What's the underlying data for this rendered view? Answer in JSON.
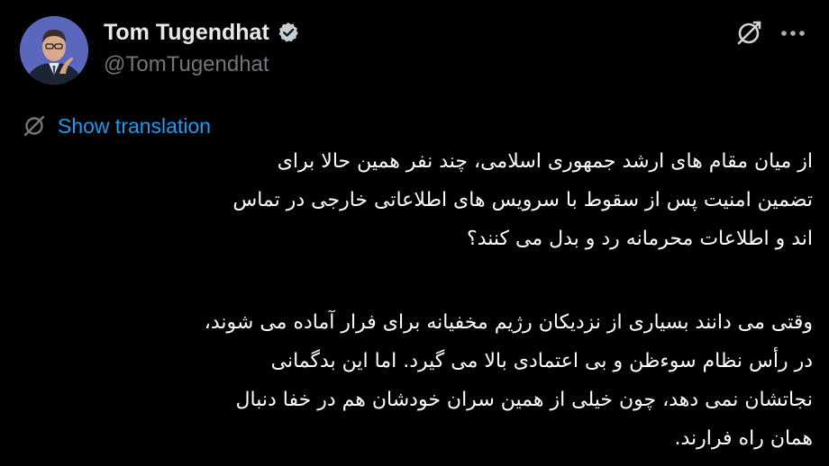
{
  "author": {
    "display_name": "Tom Tugendhat",
    "handle": "@TomTugendhat",
    "verified": true
  },
  "icons": {
    "verified": "verified-badge-icon",
    "grok": "grok-icon",
    "more": "more-options-icon",
    "translate": "translate-icon"
  },
  "translation": {
    "label": "Show translation"
  },
  "colors": {
    "background": "#000000",
    "text": "#ffffff",
    "secondary": "#71767b",
    "link": "#1d9bf0"
  },
  "tweet": {
    "paragraphs": [
      {
        "lines": [
          "از میان مقام های ارشد جمهوری اسلامی، چند نفر همین حالا برای",
          "تضمین امنیت پس از سقوط با سرویس های اطلاعاتی خارجی در تماس",
          "اند و اطلاعات محرمانه رد و بدل می کنند؟"
        ]
      },
      {
        "lines": [
          "وقتی می دانند بسیاری از نزدیکان رژیم مخفیانه برای فرار آماده می شوند،",
          "در رأس نظام سوءظن و بی اعتمادی بالا می گیرد. اما این بدگمانی",
          "نجاتشان نمی دهد، چون خیلی از همین سران خودشان هم در خفا دنبال",
          "همان راه فرارند."
        ]
      }
    ]
  }
}
